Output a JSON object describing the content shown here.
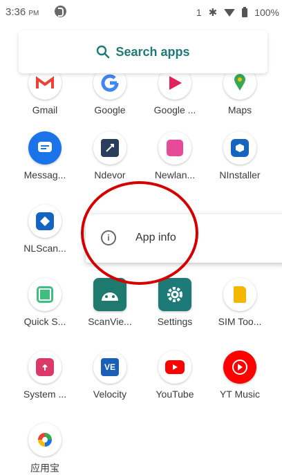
{
  "status_bar": {
    "time": "3:36",
    "ampm": "PM",
    "notification_count": "1",
    "battery_percent": "100%"
  },
  "search": {
    "label": "Search apps"
  },
  "apps": [
    {
      "label": "Gmail"
    },
    {
      "label": "Google"
    },
    {
      "label": "Google ..."
    },
    {
      "label": "Maps"
    },
    {
      "label": "Messag..."
    },
    {
      "label": "Ndevor"
    },
    {
      "label": "Newlan..."
    },
    {
      "label": "NInstaller"
    },
    {
      "label": "NLScan..."
    },
    {
      "label": "Quick S..."
    },
    {
      "label": "ScanVie..."
    },
    {
      "label": "Settings"
    },
    {
      "label": "SIM Too..."
    },
    {
      "label": "System ..."
    },
    {
      "label": "Velocity"
    },
    {
      "label": "YouTube"
    },
    {
      "label": "YT Music"
    },
    {
      "label": "应用宝"
    }
  ],
  "popup": {
    "item_label": "App info"
  },
  "colors": {
    "accent": "#1d7a78",
    "highlight_ring": "#d40000"
  }
}
